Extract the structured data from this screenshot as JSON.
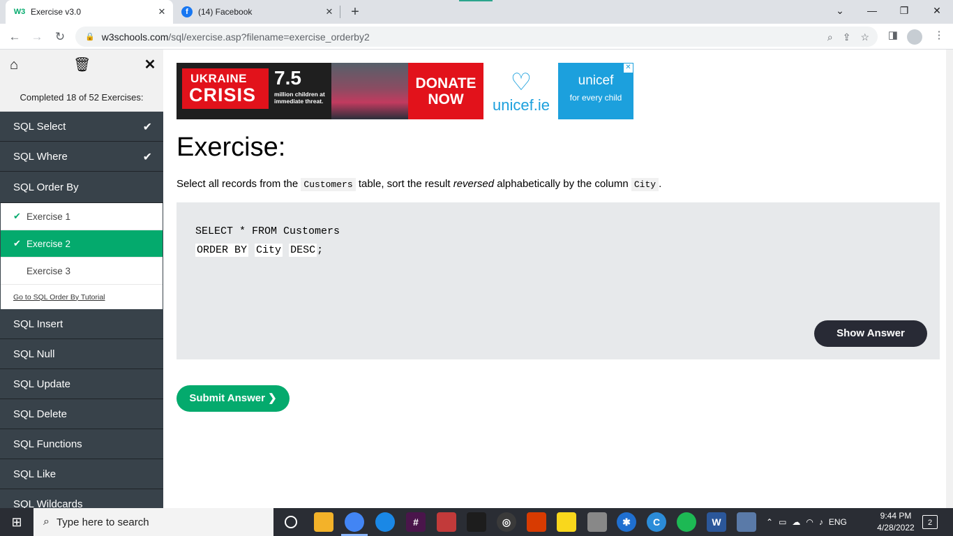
{
  "browser": {
    "tabs": [
      {
        "title": "Exercise v3.0",
        "favicon": "W3"
      },
      {
        "title": "(14) Facebook",
        "favicon": "f"
      }
    ],
    "new_tab": "+",
    "url_host": "w3schools.com",
    "url_path": "/sql/exercise.asp?filename=exercise_orderby2"
  },
  "sidebar": {
    "progress": "Completed 18 of 52 Exercises:",
    "sections_before": [
      {
        "label": "SQL Select",
        "completed": true
      },
      {
        "label": "SQL Where",
        "completed": true
      }
    ],
    "open_section": {
      "label": "SQL Order By",
      "exercises": [
        {
          "label": "Exercise 1",
          "completed": true,
          "active": false
        },
        {
          "label": "Exercise 2",
          "completed": true,
          "active": true
        },
        {
          "label": "Exercise 3",
          "completed": false,
          "active": false
        }
      ],
      "tutorial_link": "Go to SQL Order By Tutorial"
    },
    "sections_after": [
      {
        "label": "SQL Insert"
      },
      {
        "label": "SQL Null"
      },
      {
        "label": "SQL Update"
      },
      {
        "label": "SQL Delete"
      },
      {
        "label": "SQL Functions"
      },
      {
        "label": "SQL Like"
      },
      {
        "label": "SQL Wildcards"
      }
    ]
  },
  "ad": {
    "headline_1": "UKRAINE",
    "headline_2": "CRISIS",
    "figure": "7.5",
    "figure_text": "million children at immediate threat.",
    "donate_1": "DONATE",
    "donate_2": "NOW",
    "brand_ie": "unicef.ie",
    "brand": "unicef",
    "tagline": "for every child"
  },
  "exercise": {
    "title": "Exercise:",
    "instruction_1": "Select all records from the",
    "table_name": "Customers",
    "instruction_2": "table, sort the result",
    "instruction_em": "reversed",
    "instruction_3": "alphabetically by the column",
    "column_name": "City",
    "instruction_end": ".",
    "code_line1": "SELECT * FROM Customers",
    "code_kw1": "ORDER BY",
    "code_blank_col": "City",
    "code_blank_dir": "DESC",
    "code_end": ";",
    "show_answer": "Show Answer",
    "submit": "Submit Answer ❯"
  },
  "taskbar": {
    "search_placeholder": "Type here to search",
    "language": "ENG",
    "time": "9:44 PM",
    "date": "4/28/2022",
    "notifications": "2"
  },
  "colors": {
    "sidebar_bg": "#38424a",
    "accent_green": "#04aa6d",
    "code_bg": "#e7e9eb",
    "dark_button": "#282a35"
  }
}
